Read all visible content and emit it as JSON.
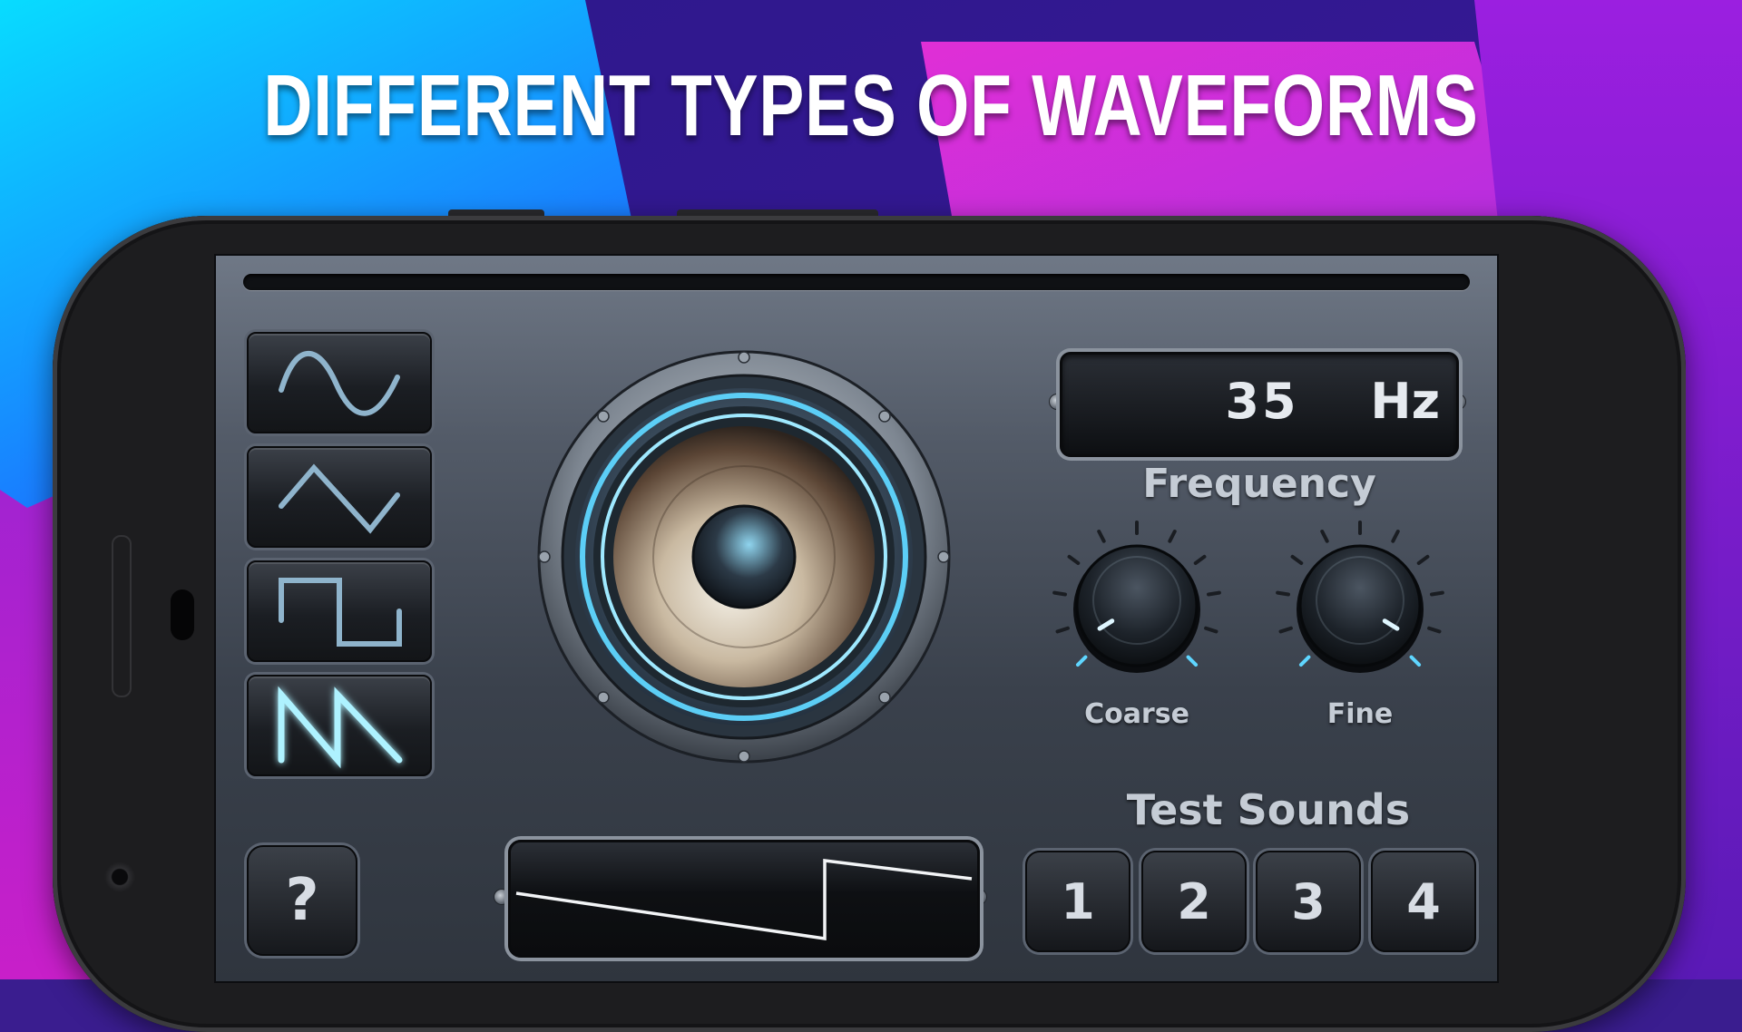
{
  "banner": {
    "headline": "DIFFERENT TYPES OF WAVEFORMS"
  },
  "colors": {
    "accent_glow": "#5fd6ff",
    "bg_cyan": "#0ad2ff",
    "bg_blue": "#1f6dff",
    "bg_indigo": "#2e1a86",
    "bg_magenta": "#d52ed8",
    "bg_purple": "#8a1fd6"
  },
  "waveform_selector": {
    "items": [
      {
        "name": "sine",
        "icon": "sine-wave-icon",
        "selected": false
      },
      {
        "name": "triangle",
        "icon": "triangle-wave-icon",
        "selected": false
      },
      {
        "name": "square",
        "icon": "square-wave-icon",
        "selected": false
      },
      {
        "name": "sawtooth",
        "icon": "sawtooth-wave-icon",
        "selected": true
      }
    ]
  },
  "help": {
    "label": "?"
  },
  "frequency": {
    "value": "35",
    "unit": "Hz",
    "label": "Frequency"
  },
  "knobs": {
    "coarse": {
      "label": "Coarse",
      "level": 0.05
    },
    "fine": {
      "label": "Fine",
      "level": 0.95
    }
  },
  "test_sounds": {
    "title": "Test Sounds",
    "buttons": [
      "1",
      "2",
      "3",
      "4"
    ]
  }
}
